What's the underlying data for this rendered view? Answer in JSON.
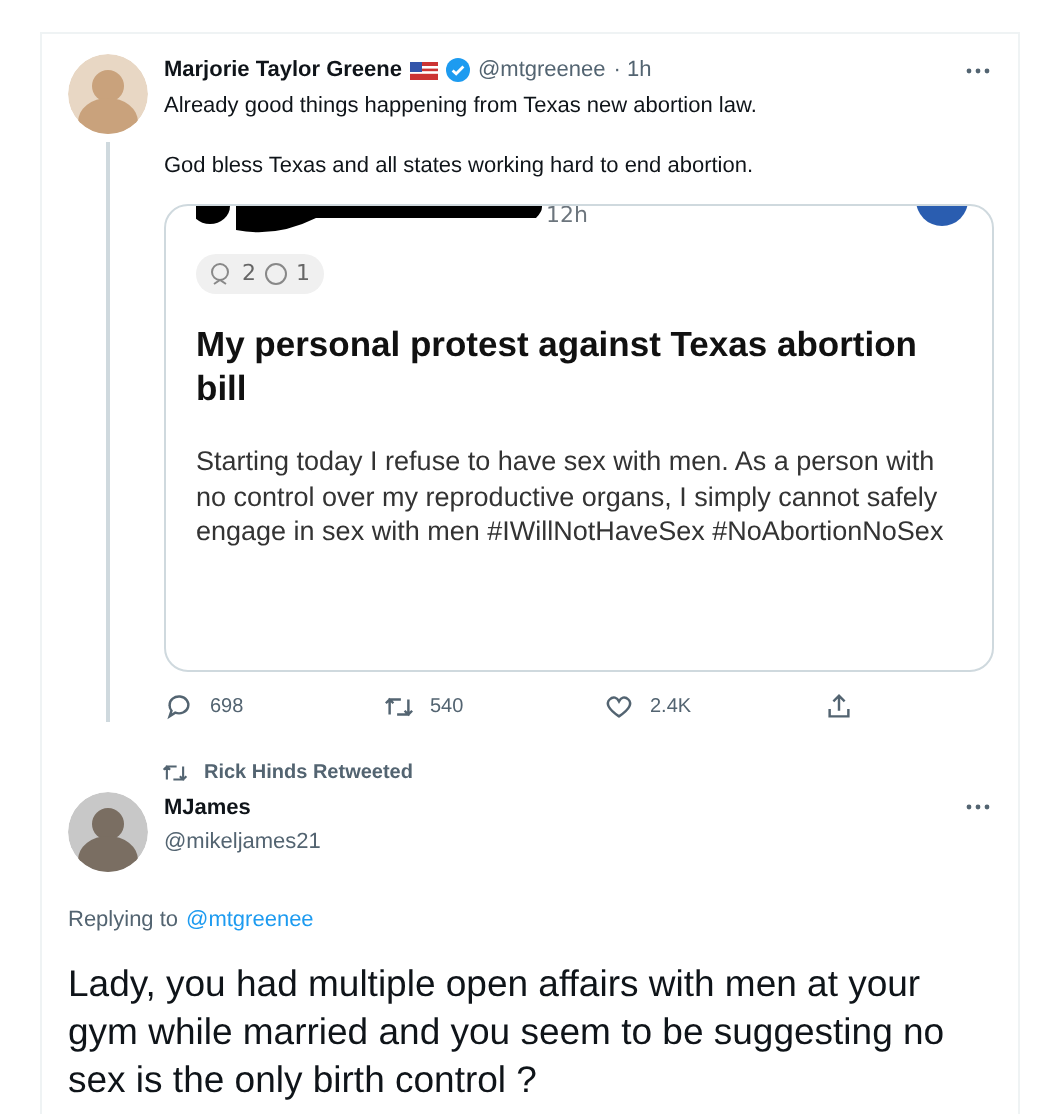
{
  "tweet": {
    "author": "Marjorie Taylor Greene",
    "handle": "@mtgreenee",
    "time": "· 1h",
    "verified": true,
    "paragraphs": [
      "Already good things happening from Texas new abortion law.",
      "God bless Texas and all states working hard to end abortion."
    ],
    "embedded_screenshot": {
      "time": "12h",
      "reaction_count": "2",
      "comment_count": "1",
      "title": "My personal protest against Texas abortion bill",
      "body": "Starting today I refuse to have sex with men. As a person with no control over my reproductive organs, I simply cannot safely engage in sex with men #IWillNotHaveSex #NoAbortionNoSex"
    },
    "actions": [
      {
        "kind": "reply",
        "count": "698"
      },
      {
        "kind": "retweet",
        "count": "540"
      },
      {
        "kind": "like",
        "count": "2.4K"
      },
      {
        "kind": "share"
      }
    ]
  },
  "retweeted_by": "Rick Hinds Retweeted",
  "reply": {
    "author": "MJames",
    "handle": "@mikeljames21",
    "replying_label": "Replying to",
    "replying_to": "@mtgreenee",
    "text": "Lady, you had multiple open affairs with men at your gym while married and you seem to be suggesting no sex is the only birth control ?"
  }
}
